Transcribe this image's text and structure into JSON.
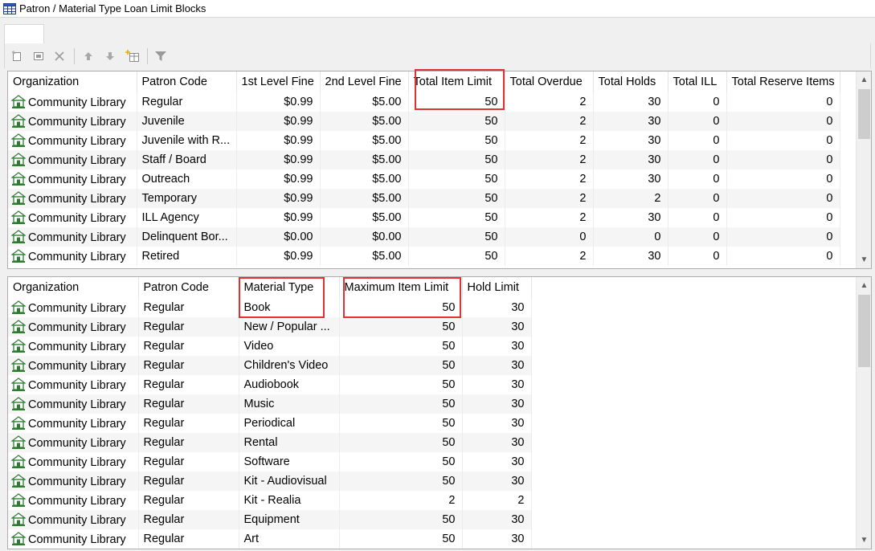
{
  "window": {
    "title": "Patron / Material Type Loan Limit Blocks"
  },
  "toolbar": {
    "buttons": [
      "new-icon",
      "edit-icon",
      "delete-icon",
      "move-up-icon",
      "move-down-icon",
      "add-column-icon",
      "filter-icon"
    ]
  },
  "top_grid": {
    "columns": [
      "Organization",
      "Patron Code",
      "1st Level Fine",
      "2nd Level Fine",
      "Total Item Limit",
      "Total Overdue",
      "Total Holds",
      "Total ILL",
      "Total Reserve Items"
    ],
    "rows": [
      [
        "Community Library",
        "Regular",
        "$0.99",
        "$5.00",
        "50",
        "2",
        "30",
        "0",
        "0"
      ],
      [
        "Community Library",
        "Juvenile",
        "$0.99",
        "$5.00",
        "50",
        "2",
        "30",
        "0",
        "0"
      ],
      [
        "Community Library",
        "Juvenile with R...",
        "$0.99",
        "$5.00",
        "50",
        "2",
        "30",
        "0",
        "0"
      ],
      [
        "Community Library",
        "Staff / Board",
        "$0.99",
        "$5.00",
        "50",
        "2",
        "30",
        "0",
        "0"
      ],
      [
        "Community Library",
        "Outreach",
        "$0.99",
        "$5.00",
        "50",
        "2",
        "30",
        "0",
        "0"
      ],
      [
        "Community Library",
        "Temporary",
        "$0.99",
        "$5.00",
        "50",
        "2",
        "2",
        "0",
        "0"
      ],
      [
        "Community Library",
        "ILL Agency",
        "$0.99",
        "$5.00",
        "50",
        "2",
        "30",
        "0",
        "0"
      ],
      [
        "Community Library",
        "Delinquent Bor...",
        "$0.00",
        "$0.00",
        "50",
        "0",
        "0",
        "0",
        "0"
      ],
      [
        "Community Library",
        "Retired",
        "$0.99",
        "$5.00",
        "50",
        "2",
        "30",
        "0",
        "0"
      ]
    ]
  },
  "bottom_grid": {
    "columns": [
      "Organization",
      "Patron Code",
      "Material Type",
      "Maximum Item Limit",
      "Hold Limit"
    ],
    "rows": [
      [
        "Community Library",
        "Regular",
        "Book",
        "50",
        "30"
      ],
      [
        "Community Library",
        "Regular",
        "New / Popular ...",
        "50",
        "30"
      ],
      [
        "Community Library",
        "Regular",
        "Video",
        "50",
        "30"
      ],
      [
        "Community Library",
        "Regular",
        "Children's Video",
        "50",
        "30"
      ],
      [
        "Community Library",
        "Regular",
        "Audiobook",
        "50",
        "30"
      ],
      [
        "Community Library",
        "Regular",
        "Music",
        "50",
        "30"
      ],
      [
        "Community Library",
        "Regular",
        "Periodical",
        "50",
        "30"
      ],
      [
        "Community Library",
        "Regular",
        "Rental",
        "50",
        "30"
      ],
      [
        "Community Library",
        "Regular",
        "Software",
        "50",
        "30"
      ],
      [
        "Community Library",
        "Regular",
        "Kit - Audiovisual",
        "50",
        "30"
      ],
      [
        "Community Library",
        "Regular",
        "Kit - Realia",
        "2",
        "2"
      ],
      [
        "Community Library",
        "Regular",
        "Equipment",
        "50",
        "30"
      ],
      [
        "Community Library",
        "Regular",
        "Art",
        "50",
        "30"
      ]
    ]
  },
  "colors": {
    "highlight": "#e03232",
    "org_icon": "#2e7d32"
  }
}
